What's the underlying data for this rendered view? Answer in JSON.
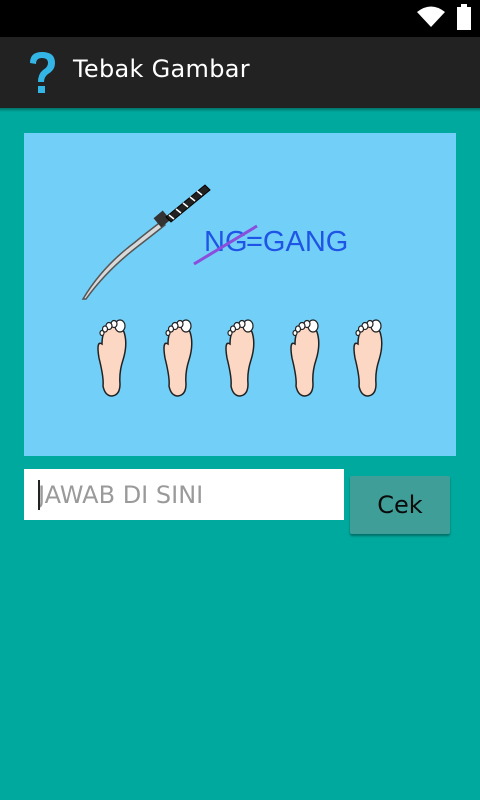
{
  "app": {
    "title": "Tebak Gambar",
    "icon": "question-mark-icon"
  },
  "status_bar": {
    "icons": [
      "wifi-icon",
      "battery-icon"
    ]
  },
  "puzzle": {
    "image_description_icons": [
      "katana-icon",
      "foot-icon"
    ],
    "struck_text": "NG",
    "equation_text": "=GANG",
    "foot_count": 5
  },
  "answer": {
    "placeholder": "JAWAB DI SINI",
    "value": ""
  },
  "actions": {
    "check_label": "Cek"
  },
  "colors": {
    "background": "#00a99e",
    "action_bar": "#222222",
    "puzzle_background": "#72cff7",
    "button": "#3f9f98",
    "logo": "#33b5e5",
    "equation_text": "#1f55e6",
    "strike": "#8a4ddc"
  }
}
